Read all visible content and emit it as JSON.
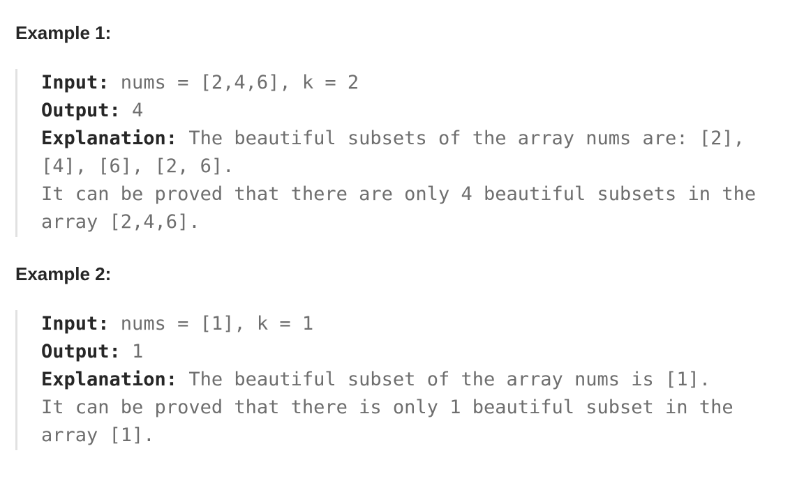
{
  "examples": [
    {
      "title": "Example 1:",
      "input_label": "Input:",
      "input_value": " nums = [2,4,6], k = 2",
      "output_label": "Output:",
      "output_value": " 4",
      "explanation_label": "Explanation:",
      "explanation_lines": [
        " The beautiful subsets of the array nums are: [2],",
        "[4], [6], [2, 6].",
        "It can be proved that there are only 4 beautiful subsets in the",
        "array [2,4,6]."
      ]
    },
    {
      "title": "Example 2:",
      "input_label": "Input:",
      "input_value": " nums = [1], k = 1",
      "output_label": "Output:",
      "output_value": " 1",
      "explanation_label": "Explanation:",
      "explanation_lines": [
        " The beautiful subset of the array nums is [1].",
        "It can be proved that there is only 1 beautiful subset in the",
        "array [1]."
      ]
    }
  ]
}
